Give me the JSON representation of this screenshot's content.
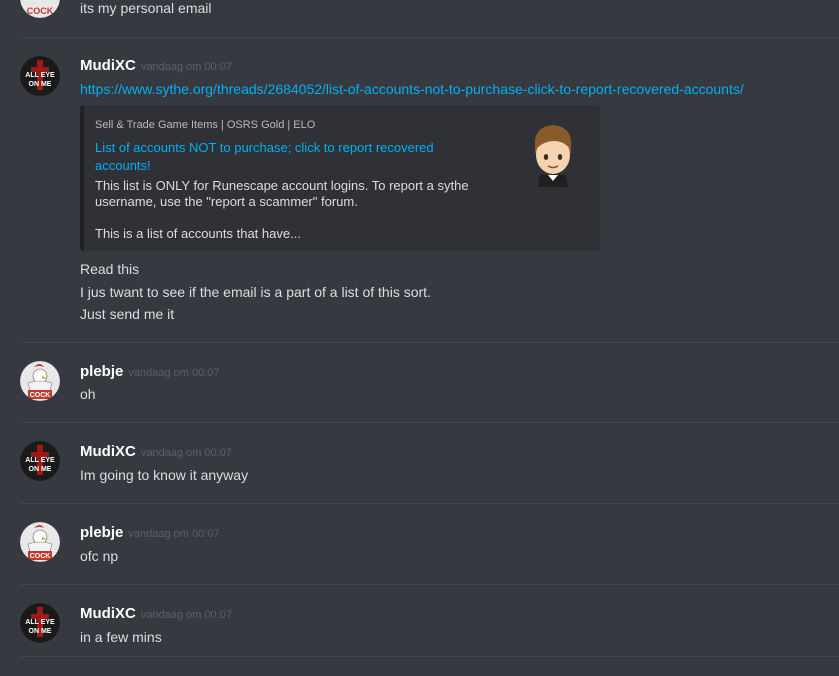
{
  "top_partial": {
    "text": "its my personal email",
    "avatar_label": "COCK"
  },
  "messages": [
    {
      "username": "MudiXC",
      "timestamp": "vandaag om 00:07",
      "link": "https://www.sythe.org/threads/2684052/list-of-accounts-not-to-purchase-click-to-report-recovered-accounts/",
      "embed": {
        "provider": "Sell & Trade Game Items | OSRS Gold | ELO",
        "title": "List of accounts NOT to purchase; click to report recovered accounts!",
        "description": "This list is ONLY for Runescape account logins. To report a sythe username, use the \"report a scammer\" forum.",
        "description2": "This is a list of accounts that have..."
      },
      "lines": [
        "Read this",
        "I jus twant to see if the email is a part of a list of this sort.",
        "Just send me it"
      ]
    },
    {
      "username": "plebje",
      "timestamp": "vandaag om 00:07",
      "lines": [
        "oh"
      ]
    },
    {
      "username": "MudiXC",
      "timestamp": "vandaag om 00:07",
      "lines": [
        "Im going to know it anyway"
      ]
    },
    {
      "username": "plebje",
      "timestamp": "vandaag om 00:07",
      "lines": [
        "ofc np"
      ]
    },
    {
      "username": "MudiXC",
      "timestamp": "vandaag om 00:07",
      "lines": [
        "in a few mins"
      ]
    }
  ],
  "avatars": {
    "mudixc_top": "ALL EYE",
    "mudixc_bottom": "ON ME",
    "plebje_label": "COCK"
  },
  "colors": {
    "background": "#36393f",
    "link": "#00b0f4",
    "username": "#ffffff",
    "timestamp": "#5c5f64",
    "text": "#dcddde",
    "embed_bg": "#2f3136"
  }
}
